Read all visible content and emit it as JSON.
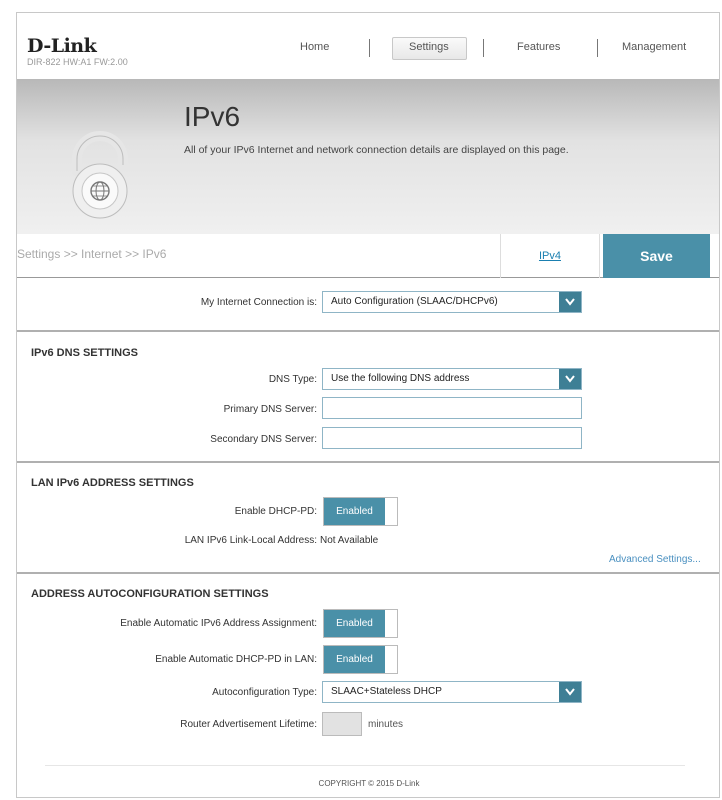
{
  "brand": {
    "logo": "D-Link",
    "model": "DIR-822 HW:A1 FW:2.00"
  },
  "nav": {
    "home": "Home",
    "settings": "Settings",
    "features": "Features",
    "management": "Management"
  },
  "banner": {
    "title": "IPv6",
    "description": "All of your IPv6 Internet and network connection details are displayed on this page."
  },
  "breadcrumb": "Settings >> Internet >> IPv6",
  "actions": {
    "ipv4": "IPv4",
    "save": "Save"
  },
  "connection": {
    "label": "My Internet Connection is:",
    "value": "Auto Configuration (SLAAC/DHCPv6)"
  },
  "dns": {
    "title": "IPv6 DNS SETTINGS",
    "type_label": "DNS Type:",
    "type_value": "Use the following DNS address",
    "primary_label": "Primary DNS Server:",
    "primary_value": "",
    "secondary_label": "Secondary DNS Server:",
    "secondary_value": ""
  },
  "lan": {
    "title": "LAN IPv6 ADDRESS SETTINGS",
    "dhcp_pd_label": "Enable DHCP-PD:",
    "dhcp_pd_value": "Enabled",
    "link_local_label": "LAN IPv6 Link-Local Address:",
    "link_local_value": "Not Available",
    "advanced": "Advanced Settings..."
  },
  "autoconf": {
    "title": "ADDRESS AUTOCONFIGURATION SETTINGS",
    "auto_assign_label": "Enable Automatic IPv6 Address Assignment:",
    "auto_assign_value": "Enabled",
    "auto_dhcp_pd_label": "Enable Automatic DHCP-PD in LAN:",
    "auto_dhcp_pd_value": "Enabled",
    "type_label": "Autoconfiguration Type:",
    "type_value": "SLAAC+Stateless DHCP",
    "lifetime_label": "Router Advertisement Lifetime:",
    "lifetime_value": "",
    "lifetime_unit": "minutes"
  },
  "footer": "COPYRIGHT © 2015 D-Link",
  "colors": {
    "accent": "#4a90a8",
    "dropdown_arrow": "#3e7f95",
    "link": "#1a7fb0"
  }
}
